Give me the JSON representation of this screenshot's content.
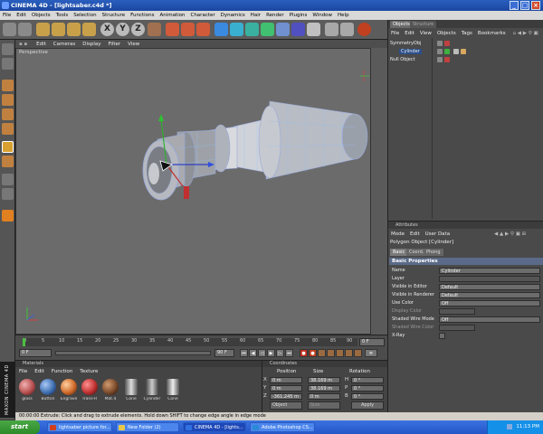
{
  "window": {
    "title": "CINEMA 4D - [lightsaber.c4d *]",
    "controls": [
      "_",
      "□",
      "×"
    ]
  },
  "menubar": [
    "File",
    "Edit",
    "Objects",
    "Tools",
    "Selection",
    "Structure",
    "Functions",
    "Animation",
    "Character",
    "Dynamics",
    "Hair",
    "Render",
    "Plugins",
    "Window",
    "Help"
  ],
  "viewport": {
    "menu": [
      "Edit",
      "Cameras",
      "Display",
      "Filter",
      "View"
    ],
    "label": "Perspective"
  },
  "timeline": {
    "ticks": [
      "0",
      "5",
      "10",
      "15",
      "20",
      "25",
      "30",
      "35",
      "40",
      "45",
      "50",
      "55",
      "60",
      "65",
      "70",
      "75",
      "80",
      "85",
      "90"
    ],
    "current_frame": "0 F",
    "start_frame": "0 F",
    "end_frame": "90 F",
    "fps_field": "0 F"
  },
  "materials": {
    "title": "Materials",
    "menu": [
      "File",
      "Edit",
      "Function",
      "Texture"
    ],
    "items": [
      {
        "label": "glass",
        "color": "#b85050"
      },
      {
        "label": "Button",
        "color": "#3f6fb0"
      },
      {
        "label": "Engrave",
        "color": "#d06a2a"
      },
      {
        "label": "Trans-R",
        "color": "#c03030"
      },
      {
        "label": "Mat.4",
        "color": "#7a4a2a"
      },
      {
        "label": "Cone",
        "color": "#9a9a9a"
      },
      {
        "label": "Cylinder",
        "color": "#8a8a8a"
      },
      {
        "label": "Cone",
        "color": "#a0a0a0"
      }
    ]
  },
  "coordinates": {
    "title": "Coordinates",
    "headers": [
      "Position",
      "Size",
      "Rotation"
    ],
    "rows": [
      {
        "axis": "X",
        "position": "0 m",
        "size": "38.169 m",
        "rot_axis": "H",
        "rotation": "0 °"
      },
      {
        "axis": "Y",
        "position": "0 m",
        "size": "38.169 m",
        "rot_axis": "P",
        "rotation": "0 °"
      },
      {
        "axis": "Z",
        "position": "-361.245 m",
        "size": "0 m",
        "rot_axis": "B",
        "rotation": "0 °"
      }
    ],
    "mode": "Object",
    "size_mode": "Size",
    "apply": "Apply"
  },
  "status": "00:00:00    Extrude: Click and drag to extrude elements. Hold down SHIFT to change edge angle in edge mode",
  "objects": {
    "tabs": [
      "Objects",
      "Structure"
    ],
    "menu": [
      "File",
      "Edit",
      "View",
      "Objects",
      "Tags",
      "Bookmarks"
    ],
    "tree": [
      {
        "label": "SymmetryObj",
        "indent": 0,
        "selected": false
      },
      {
        "label": "Cylinder",
        "indent": 1,
        "selected": true
      },
      {
        "label": "Null Object",
        "indent": 0,
        "selected": false
      }
    ]
  },
  "attributes": {
    "title": "Attributes",
    "menu": [
      "Mode",
      "Edit",
      "User Data"
    ],
    "object": "Polygon Object [Cylinder]",
    "tabs": [
      "Basic",
      "Coord.",
      "Phong"
    ],
    "section": "Basic Properties",
    "rows": [
      {
        "label": "Name",
        "value": "Cylinder",
        "disabled": false
      },
      {
        "label": "Layer",
        "value": "",
        "disabled": false
      },
      {
        "label": "Visible in Editor",
        "value": "Default",
        "disabled": false
      },
      {
        "label": "Visible in Renderer",
        "value": "Default",
        "disabled": false
      },
      {
        "label": "Use Color",
        "value": "Off",
        "disabled": false
      },
      {
        "label": "Display Color",
        "value": "",
        "disabled": true
      },
      {
        "label": "Shaded Wire Mode",
        "value": "Off",
        "disabled": false
      },
      {
        "label": "Shaded Wire Color",
        "value": "",
        "disabled": true
      },
      {
        "label": "X-Ray",
        "value": "",
        "disabled": false
      }
    ]
  },
  "taskbar": {
    "start": "start",
    "tasks": [
      {
        "label": "lightsaber picture for...",
        "icon_color": "#d04020",
        "active": false
      },
      {
        "label": "New Folder (2)",
        "icon_color": "#e8c84a",
        "active": false
      },
      {
        "label": "CINEMA 4D - [lights...",
        "icon_color": "#3070e0",
        "active": true
      },
      {
        "label": "Adobe Photoshop CS...",
        "icon_color": "#2a8ad8",
        "active": false
      }
    ],
    "clock": "11:13 PM"
  }
}
